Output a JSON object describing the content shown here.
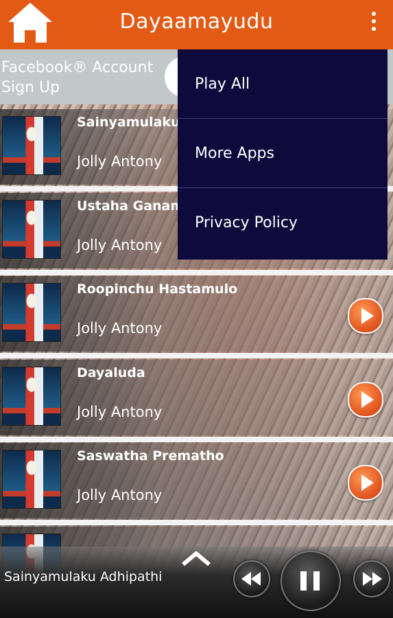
{
  "app_title": "Dayaamayudu",
  "facebook": {
    "text_line1": "Facebook® Account",
    "text_line2": "Sign Up"
  },
  "songs": [
    {
      "title": "Sainyamulaku",
      "artist": "Jolly Antony"
    },
    {
      "title": "Ustaha Ganam",
      "artist": "Jolly Antony"
    },
    {
      "title": "Roopinchu Hastamulo",
      "artist": "Jolly Antony"
    },
    {
      "title": "Dayaluda",
      "artist": "Jolly Antony"
    },
    {
      "title": "Saswatha Prematho",
      "artist": "Jolly Antony"
    }
  ],
  "menu": [
    "Play All",
    "More Apps",
    "Privacy Policy"
  ],
  "now_playing": "Sainyamulaku Adhipathi",
  "colors": {
    "appbar": "#e25a14",
    "menu_bg": "#0e0b3c",
    "play_accent": "#e0521d"
  },
  "icons": [
    "home-icon",
    "overflow-menu-icon",
    "play-icon",
    "chevron-up-icon",
    "rewind-icon",
    "pause-icon",
    "fast-forward-icon"
  ]
}
